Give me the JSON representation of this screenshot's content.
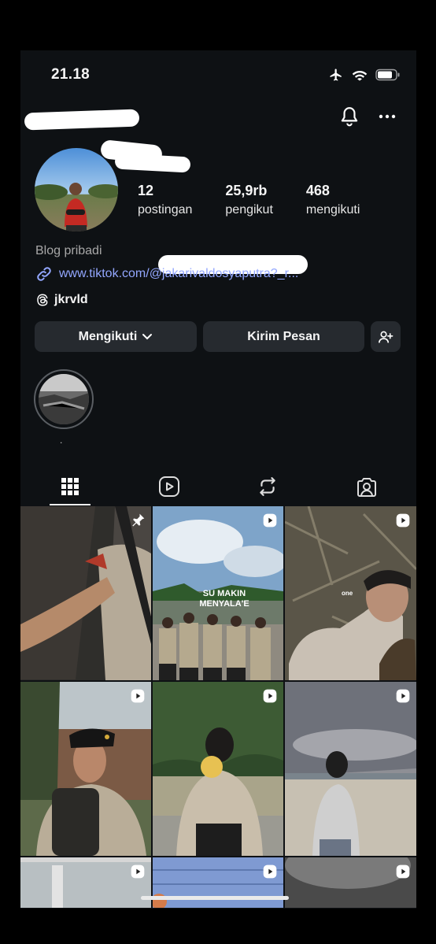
{
  "status_bar": {
    "time": "21.18"
  },
  "profile": {
    "posts_count": "12",
    "posts_label": "postingan",
    "followers_count": "25,9rb",
    "followers_label": "pengikut",
    "following_count": "468",
    "following_label": "mengikuti",
    "category": "Blog pribadi",
    "link": "www.tiktok.com/@jakarivaldosyaputra?_r...",
    "threads_handle": "jkrvld"
  },
  "actions": {
    "following_label": "Mengikuti",
    "message_label": "Kirim Pesan"
  },
  "highlights": [
    {
      "label": "."
    }
  ],
  "tabs": [
    "grid",
    "reels",
    "reposts",
    "tagged"
  ],
  "grid": {
    "video_caption_2": "SU MAKIN MENYALA'E",
    "video_caption_3": "one"
  },
  "icons": {
    "airplane": "airplane-icon",
    "wifi": "wifi-icon",
    "battery": "battery-icon",
    "bell": "bell-icon",
    "more": "more-icon",
    "link": "link-icon",
    "threads": "threads-icon",
    "chevron": "chevron-down-icon",
    "add_user": "add-user-icon",
    "pin": "pin-icon",
    "reel": "reel-icon"
  },
  "colors": {
    "background": "#0e1114",
    "button": "#262a2f",
    "link": "#93a7ff"
  }
}
